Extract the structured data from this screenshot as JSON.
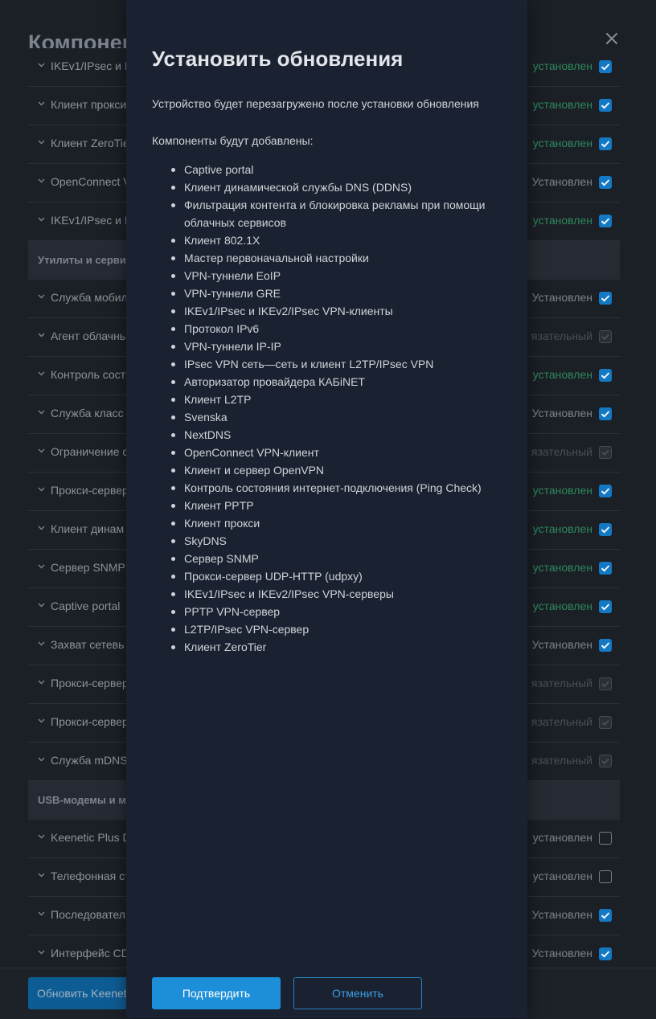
{
  "background": {
    "page_title": "Компонен",
    "rows": [
      {
        "kind": "row",
        "name": "IKEv1/IPsec и I",
        "status": "установлен",
        "status_style": "green",
        "checkbox": "checked"
      },
      {
        "kind": "row",
        "name": "Клиент прокси",
        "status": "установлен",
        "status_style": "green",
        "checkbox": "checked"
      },
      {
        "kind": "row",
        "name": "Клиент ZeroTie",
        "status": "установлен",
        "status_style": "green",
        "checkbox": "checked"
      },
      {
        "kind": "row",
        "name": "OpenConnect V",
        "status": "Установлен",
        "status_style": "white",
        "checkbox": "checked"
      },
      {
        "kind": "row",
        "name": "IKEv1/IPsec и I",
        "status": "установлен",
        "status_style": "green",
        "checkbox": "checked"
      },
      {
        "kind": "section",
        "name": "Утилиты и серви"
      },
      {
        "kind": "row",
        "name": "Служба мобил",
        "status": "Установлен",
        "status_style": "white",
        "checkbox": "checked"
      },
      {
        "kind": "row",
        "name": "Агент облачнь",
        "status": "язательный",
        "status_style": "grey",
        "checkbox": "disabled"
      },
      {
        "kind": "row",
        "name": "Контроль сост",
        "status": "установлен",
        "status_style": "green",
        "checkbox": "checked"
      },
      {
        "kind": "row",
        "name": "Служба класс",
        "status": "Установлен",
        "status_style": "white",
        "checkbox": "checked"
      },
      {
        "kind": "row",
        "name": "Ограничение с",
        "status": "язательный",
        "status_style": "grey",
        "checkbox": "disabled"
      },
      {
        "kind": "row",
        "name": "Прокси-сервер",
        "status": "установлен",
        "status_style": "green",
        "checkbox": "checked"
      },
      {
        "kind": "row",
        "name": "Клиент динам",
        "status": "установлен",
        "status_style": "green",
        "checkbox": "checked"
      },
      {
        "kind": "row",
        "name": "Сервер SNMP",
        "status": "установлен",
        "status_style": "green",
        "checkbox": "checked"
      },
      {
        "kind": "row",
        "name": "Captive portal",
        "status": "установлен",
        "status_style": "green",
        "checkbox": "checked"
      },
      {
        "kind": "row",
        "name": "Захват сетевь",
        "status": "Установлен",
        "status_style": "white",
        "checkbox": "checked"
      },
      {
        "kind": "row",
        "name": "Прокси-сервер",
        "status": "язательный",
        "status_style": "grey",
        "checkbox": "disabled"
      },
      {
        "kind": "row",
        "name": "Прокси-сервер",
        "status": "язательный",
        "status_style": "grey",
        "checkbox": "disabled"
      },
      {
        "kind": "row",
        "name": "Служба mDNS",
        "status": "язательный",
        "status_style": "grey",
        "checkbox": "disabled"
      },
      {
        "kind": "section",
        "name": "USB-модемы и м"
      },
      {
        "kind": "row",
        "name": "Keenetic Plus D",
        "status": "установлен",
        "status_style": "white",
        "checkbox": "empty"
      },
      {
        "kind": "row",
        "name": "Телефонная ст",
        "status": "установлен",
        "status_style": "white",
        "checkbox": "empty"
      },
      {
        "kind": "row",
        "name": "Последовател",
        "status": "Установлен",
        "status_style": "white",
        "checkbox": "checked"
      },
      {
        "kind": "row",
        "name": "Интерфейс CD",
        "status": "Установлен",
        "status_style": "white",
        "checkbox": "checked"
      }
    ],
    "update_button_label": "Обновить Keenetic"
  },
  "modal": {
    "title": "Установить обновления",
    "notice": "Устройство будет перезагружено после установки обновления",
    "components_heading": "Компоненты будут добавлены:",
    "components": [
      "Captive portal",
      "Клиент динамической службы DNS (DDNS)",
      "Фильтрация контента и блокировка рекламы при помощи облачных сервисов",
      "Клиент 802.1X",
      "Мастер первоначальной настройки",
      "VPN-туннели EoIP",
      "VPN-туннели GRE",
      "IKEv1/IPsec и IKEv2/IPsec VPN-клиенты",
      "Протокол IPv6",
      "VPN-туннели IP-IP",
      "IPsec VPN сеть—сеть и клиент L2TP/IPsec VPN",
      "Авторизатор провайдера КАБiNET",
      "Клиент L2TP",
      "Svenska",
      "NextDNS",
      "OpenConnect VPN-клиент",
      "Клиент и сервер OpenVPN",
      "Контроль состояния интернет-подключения (Ping Check)",
      "Клиент PPTP",
      "Клиент прокси",
      "SkyDNS",
      "Сервер SNMP",
      "Прокси-сервер UDP-HTTP (udpxy)",
      "IKEv1/IPsec и IKEv2/IPsec VPN-серверы",
      "PPTP VPN-сервер",
      "L2TP/IPsec VPN-сервер",
      "Клиент ZeroTier"
    ],
    "confirm_label": "Подтвердить",
    "cancel_label": "Отменить"
  },
  "icons": {
    "close": "close-icon",
    "chevron": "chevron-down-icon",
    "check": "check-icon"
  },
  "colors": {
    "accent": "#1c8fd8",
    "checkbox_checked": "#1479c4",
    "status_green": "#2e8a5b",
    "modal_bg": "#1a2231"
  }
}
